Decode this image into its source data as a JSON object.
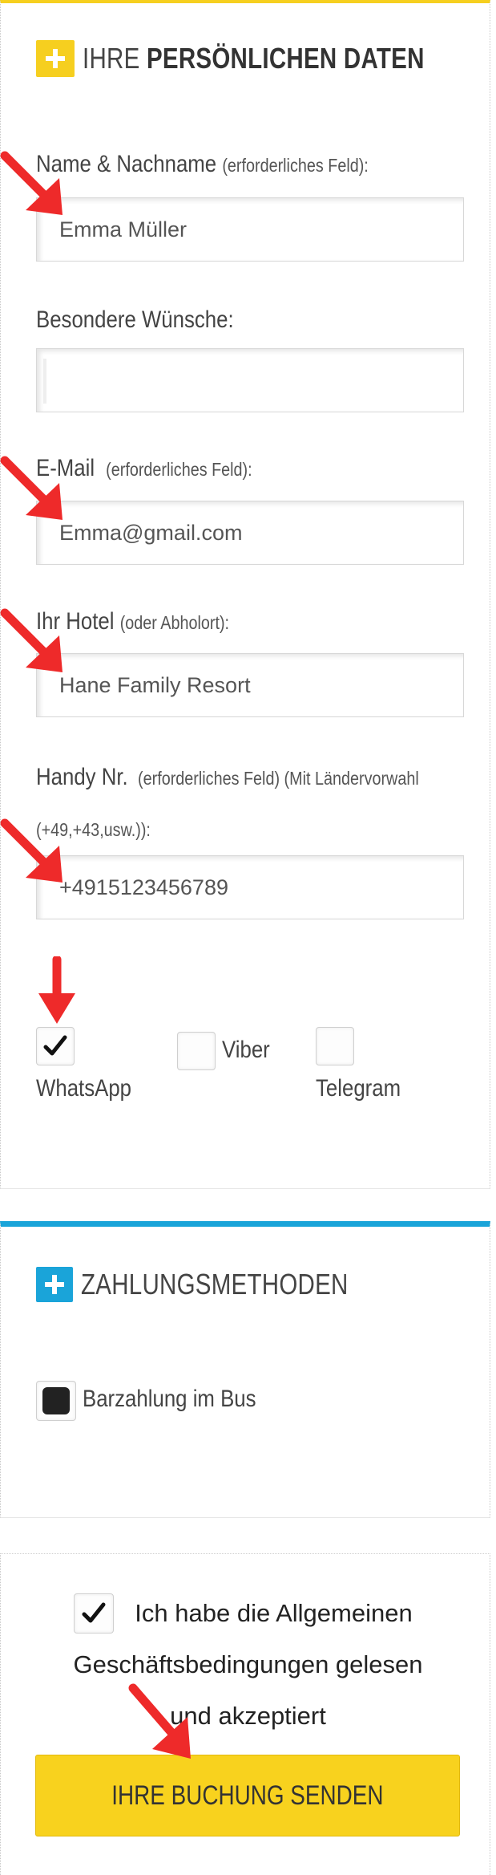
{
  "personal": {
    "title_light": "IHRE",
    "title_bold": "PERSÖNLICHEN DATEN",
    "name_label": "Name & Nachname",
    "name_note": "(erforderliches Feld):",
    "name_value": "Emma Müller",
    "wishes_label": "Besondere Wünsche:",
    "wishes_value": "",
    "email_label": "E-Mail",
    "email_note": "(erforderliches Feld):",
    "email_value": "Emma@gmail.com",
    "hotel_label": "Ihr Hotel",
    "hotel_note": "(oder Abholort):",
    "hotel_value": "Hane Family Resort",
    "phone_label": "Handy Nr.",
    "phone_note": "(erforderliches Feld) (Mit Ländervorwahl",
    "phone_note2": "(+49,+43,usw.)):",
    "phone_value": "+4915123456789",
    "messengers": [
      {
        "label": "WhatsApp",
        "checked": true
      },
      {
        "label": "Viber",
        "checked": false
      },
      {
        "label": "Telegram",
        "checked": false
      }
    ]
  },
  "payment": {
    "title": "ZAHLUNGSMETHODEN",
    "option_label": "Barzahlung im Bus",
    "option_selected": true
  },
  "terms": {
    "line1": "Ich habe die Allgemeinen",
    "line2": "Geschäftsbedingungen gelesen",
    "line3": "und akzeptiert",
    "checked": true
  },
  "submit_label": "IHRE BUCHUNG SENDEN",
  "colors": {
    "yellow": "#f6cf1f",
    "blue": "#1aa4d9",
    "arrow_red": "#ee2a2a"
  }
}
